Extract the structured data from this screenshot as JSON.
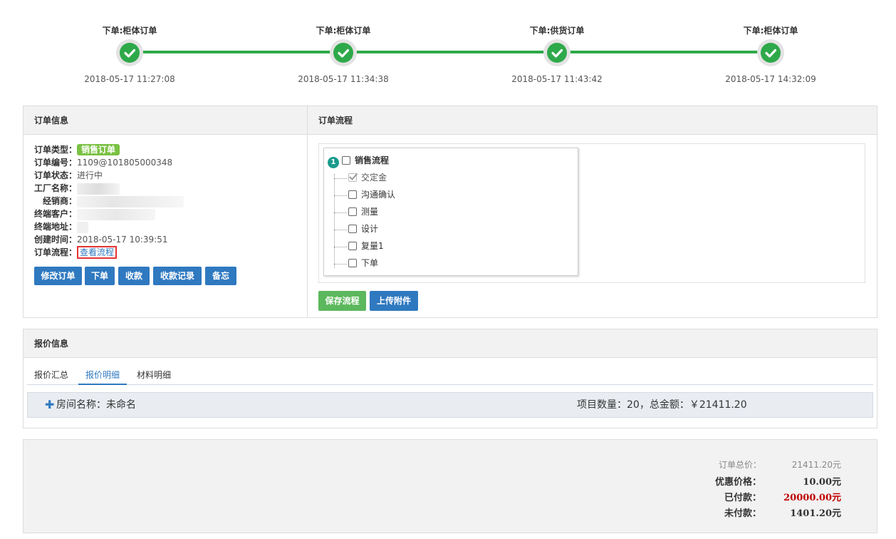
{
  "steps": [
    {
      "title": "下单:柜体订单",
      "time": "2018-05-17 11:27:08"
    },
    {
      "title": "下单:柜体订单",
      "time": "2018-05-17 11:34:38"
    },
    {
      "title": "下单:供货订单",
      "time": "2018-05-17 11:43:42"
    },
    {
      "title": "下单:柜体订单",
      "time": "2018-05-17 14:32:09"
    }
  ],
  "order_info": {
    "heading": "订单信息",
    "type_label": "订单类型：",
    "type_value": "销售订单",
    "number_label": "订单编号：",
    "number_value": "1109@101805000348",
    "status_label": "订单状态：",
    "status_value": "进行中",
    "factory_label": "工厂名称：",
    "dealer_label": "经销商：",
    "customer_label": "终端客户：",
    "address_label": "终端地址：",
    "created_label": "创建时间：",
    "created_value": "2018-05-17 10:39:51",
    "flow_label": "订单流程：",
    "flow_link": "查看流程",
    "buttons": [
      "修改订单",
      "下单",
      "收款",
      "收款记录",
      "备忘"
    ]
  },
  "order_flow": {
    "heading": "订单流程",
    "root_number": "1",
    "root_label": "销售流程",
    "items": [
      {
        "label": "交定金",
        "checked": true
      },
      {
        "label": "沟通确认",
        "checked": false
      },
      {
        "label": "测量",
        "checked": false
      },
      {
        "label": "设计",
        "checked": false
      },
      {
        "label": "复量1",
        "checked": false
      },
      {
        "label": "下单",
        "checked": false
      }
    ],
    "save_button": "保存流程",
    "upload_button": "上传附件"
  },
  "quote": {
    "heading": "报价信息",
    "tabs": [
      "报价汇总",
      "报价明细",
      "材料明细"
    ],
    "active_tab": "报价明细",
    "room_label": "房间名称：未命名",
    "room_summary": "项目数量：20，总金额：￥21411.20"
  },
  "summary": {
    "total_label": "订单总价：",
    "total_value": "21411.20元",
    "discount_label": "优惠价格：",
    "discount_value": "10.00元",
    "paid_label": "已付款：",
    "paid_value": "20000.00元",
    "unpaid_label": "未付款：",
    "unpaid_value": "1401.20元"
  },
  "colors": {
    "step_green": "#2ea94a",
    "primary_blue": "#2f79c0",
    "save_green": "#5cb85c",
    "badge_green": "#7ac142",
    "paid_red": "#c00000",
    "highlight_red": "#e53333"
  }
}
